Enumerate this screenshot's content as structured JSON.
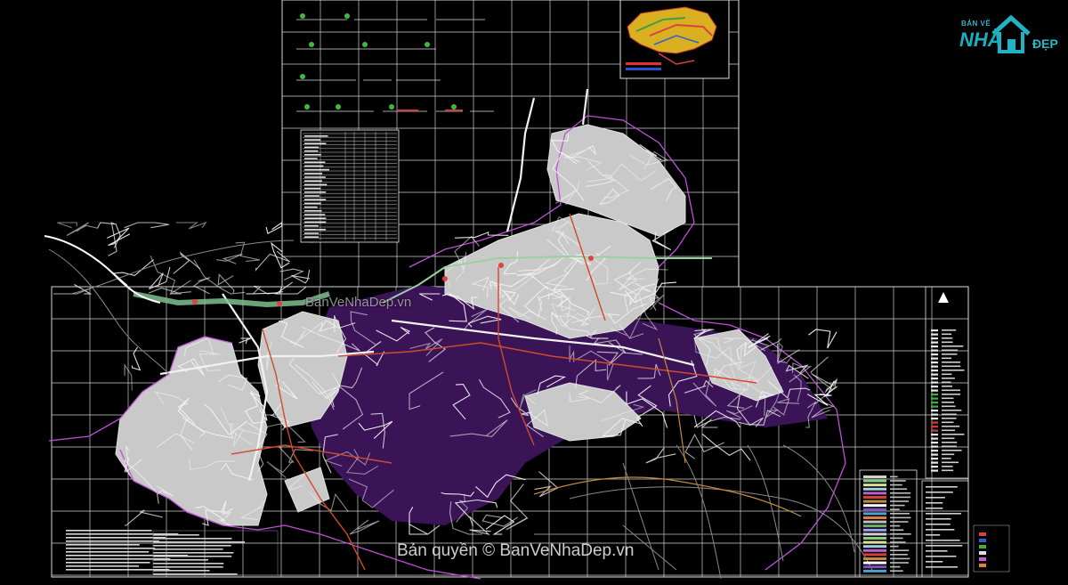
{
  "watermarks": {
    "center": "BanVeNhaDep.vn",
    "bottom": "Bản quyền © BanVeNhaDep.vn"
  },
  "logo": {
    "line1": "BẢN VẼ",
    "line2": "NHÀ",
    "line3": "ĐẸP",
    "icon": "house-icon"
  },
  "colors": {
    "background": "#000000",
    "grid": "#d8d8d8",
    "planned_area": "#c8c8c8",
    "roads": "#ffffff",
    "boundary": "#c050d8",
    "district_fill": "#4a1a6a",
    "arterial": "#e05030",
    "highway": "#7fbf8f",
    "brand": "#1fb3c5"
  }
}
